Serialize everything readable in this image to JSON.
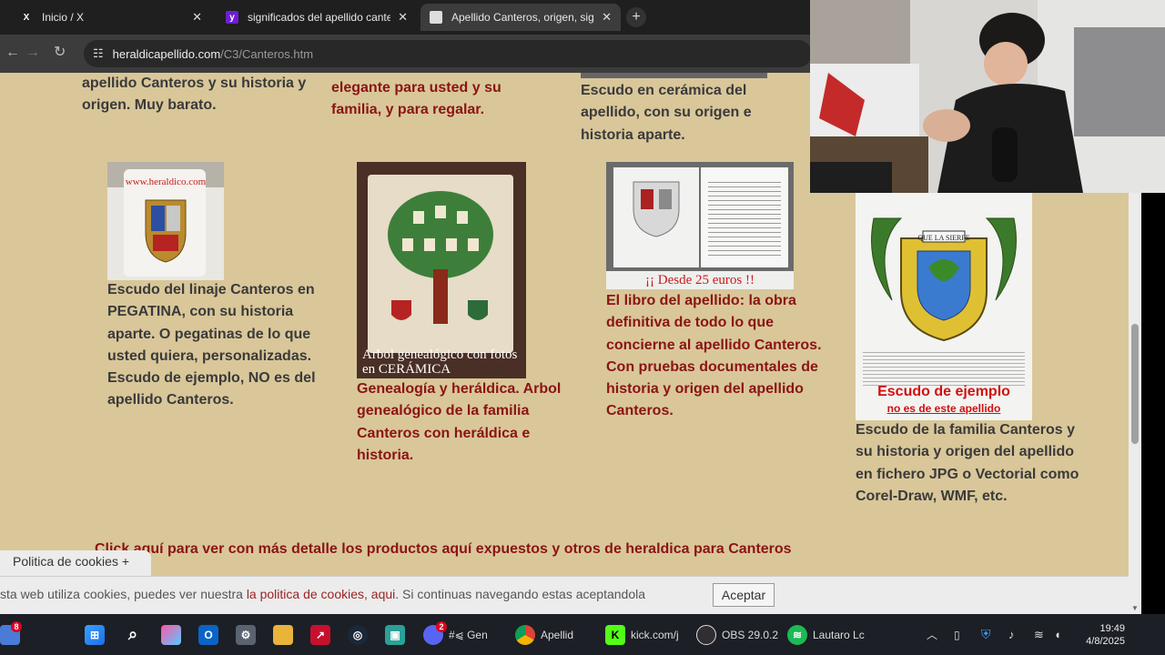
{
  "browser": {
    "tabs": [
      {
        "title": "Inicio / X",
        "favicon": "x-logo-icon"
      },
      {
        "title": "significados del apellido canteros",
        "favicon": "yahoo-icon"
      },
      {
        "title": "Apellido Canteros, origen, significado",
        "favicon": "page-icon"
      }
    ],
    "new_tab": "+",
    "url_host": "heraldicapellido.com",
    "url_path": "/C3/Canteros.htm"
  },
  "page": {
    "top_text_1": "apellido Canteros y su historia y origen. Muy barato.",
    "top_text_2": "elegante para usted y su familia, y para regalar.",
    "top_text_3": "Escudo en cerámica del apellido, con su origen e historia aparte.",
    "products": [
      {
        "image_caption": "www.heraldico.com",
        "text": "Escudo del linaje Canteros en PEGATINA, con su historia aparte. O pegatinas de lo que usted quiera, personalizadas. Escudo de ejemplo, NO es del apellido Canteros."
      },
      {
        "image_caption": "Arbol genealógico con fotos en CERÁMICA",
        "text": "Genealogía y heráldica. Arbol genealógico de la familia Canteros con heráldica e historia."
      },
      {
        "image_caption": "¡¡ Desde 25 euros !!",
        "text": "El libro del apellido: la obra definitiva de todo lo que concierne al apellido Canteros. Con pruebas documentales de historia y origen del apellido Canteros."
      },
      {
        "image_caption": "Escudo de ejemplo",
        "image_caption_2": "no es de este apellido",
        "motto": "QUE LA SIERPE",
        "text": "Escudo de la familia Canteros y su historia y origen del apellido en fichero JPG o Vectorial como Corel-Draw, WMF, etc."
      }
    ],
    "click_link": "Click aquí para ver con más detalle los productos aquí expuestos y otros de heraldica para Canteros"
  },
  "cookies": {
    "tab_label": "Politica de cookies +",
    "text_before": "sta web utiliza cookies, puedes ver nuestra ",
    "link": "la politica de cookies, aqui",
    "text_after": ". Si continuas navegando estas aceptandola",
    "accept": "Aceptar"
  },
  "taskbar": {
    "weather_badge": "8",
    "discord_badge": "2",
    "discord_label": "#⩿ Gen",
    "chrome_label": "Apellid",
    "kick_label": "kick.com/j",
    "obs_label": "OBS 29.0.2",
    "spotify_label": "Lautaro Lc",
    "time": "19:49",
    "date": "4/8/2025"
  },
  "colors": {
    "page_bg": "#d9c79a",
    "red_text": "#8b1414",
    "dark_text": "#3a3a3a"
  }
}
